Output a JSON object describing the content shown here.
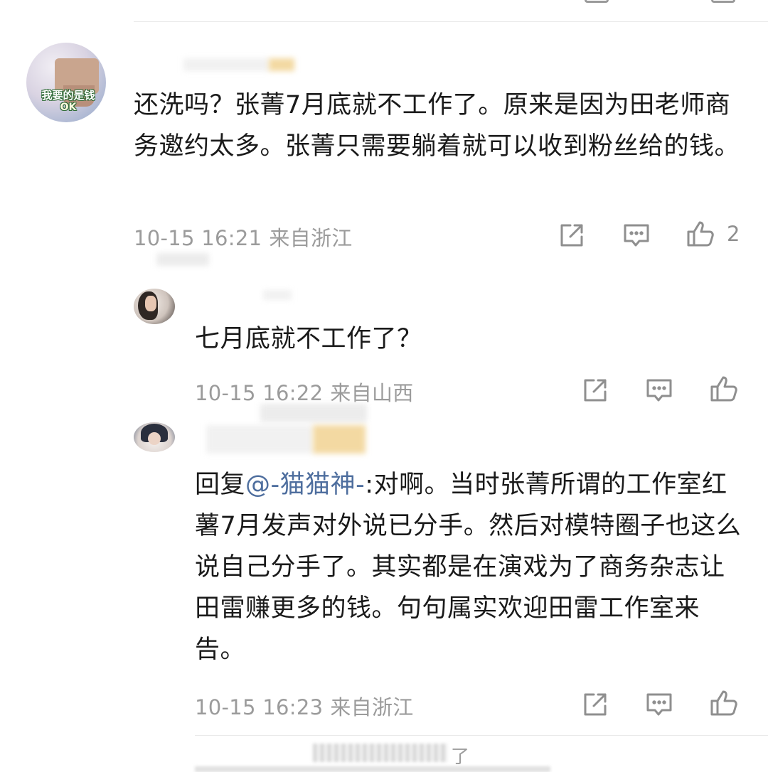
{
  "comments": {
    "main": {
      "text": "还洗吗？张菁7月底就不工作了。原来是因为田老师商务邀约太多。张菁只需要躺着就可以收到粉丝给的钱。",
      "time": "10-15 16:21",
      "location": "来自浙江",
      "like_count": "2",
      "avatar_sticker_line1": "我要的是钱",
      "avatar_sticker_line2": "OK"
    },
    "reply1": {
      "text": "七月底就不工作了？",
      "time": "10-15 16:22",
      "location": "来自山西"
    },
    "reply2": {
      "reply_prefix": "回复",
      "mention": "@-猫猫神-",
      "text": ":对啊。当时张菁所谓的工作室红薯7月发声对外说已分手。然后对模特圈子也这么说自己分手了。其实都是在演戏为了商务杂志让田雷赚更多的钱。句句属实欢迎田雷工作室来告。",
      "time": "10-15 16:23",
      "location": "来自浙江"
    }
  },
  "more_replies_suffix": "了",
  "icons": {
    "share": "share-icon",
    "comment": "comment-icon",
    "like": "thumbs-up-icon"
  },
  "colors": {
    "text": "#1a1a1a",
    "meta": "#9b9b9b",
    "mention": "#4e6e9e",
    "icon": "#8f8f8f"
  }
}
